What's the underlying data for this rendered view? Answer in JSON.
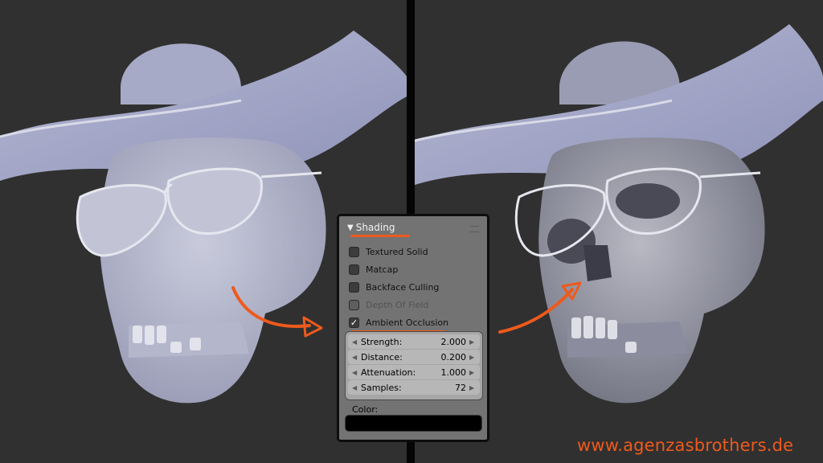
{
  "viewport_left": {
    "description_icon": "skull-render-without-ao"
  },
  "viewport_right": {
    "description_icon": "skull-render-with-ao"
  },
  "panel": {
    "title": "Shading",
    "collapse_icon": "triangle-down-icon",
    "options": [
      {
        "label": "Textured Solid",
        "checked": false,
        "enabled": true
      },
      {
        "label": "Matcap",
        "checked": false,
        "enabled": true
      },
      {
        "label": "Backface Culling",
        "checked": false,
        "enabled": true
      },
      {
        "label": "Depth Of Field",
        "checked": false,
        "enabled": false
      },
      {
        "label": "Ambient Occlusion",
        "checked": true,
        "enabled": true
      }
    ],
    "fields": [
      {
        "label": "Strength:",
        "value": "2.000"
      },
      {
        "label": "Distance:",
        "value": "0.200"
      },
      {
        "label": "Attenuation:",
        "value": "1.000"
      },
      {
        "label": "Samples:",
        "value": "72"
      }
    ],
    "color_label": "Color:",
    "color_value": "#000000"
  },
  "colors": {
    "accent": "#ee5a1c",
    "background": "#303030"
  },
  "watermark": "www.agenzasbrothers.de"
}
